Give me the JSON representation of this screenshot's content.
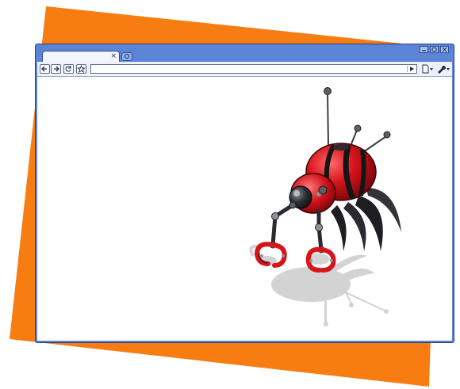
{
  "colors": {
    "accent_orange": "#f77d12",
    "frame_blue": "#5b84d6",
    "frame_border": "#23408b",
    "robot_red": "#d8141b",
    "robot_dark": "#1e1e22"
  },
  "browser": {
    "tab": {
      "close_icon": "close-icon",
      "close_glyph": "×"
    },
    "new_tab_icon": "new-tab-icon",
    "window_controls": [
      "minimize-icon",
      "maximize-icon",
      "close-icon"
    ],
    "toolbar": {
      "back_icon": "back-arrow-icon",
      "forward_icon": "forward-arrow-icon",
      "reload_icon": "reload-icon",
      "bookmark_icon": "star-icon",
      "go_icon": "play-icon",
      "page_menu_icon": "page-icon",
      "tools_menu_icon": "wrench-icon"
    },
    "address_value": ""
  },
  "content": {
    "illustration": "red-spider-robot"
  }
}
